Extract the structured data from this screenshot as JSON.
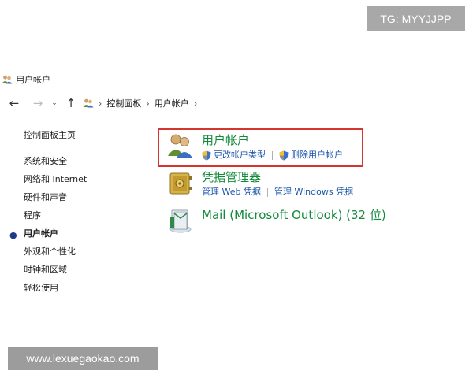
{
  "badge": {
    "text": "TG: MYYJJPP"
  },
  "window": {
    "title": "用户帐户"
  },
  "address": {
    "crumbs": [
      "控制面板",
      "用户帐户"
    ]
  },
  "sidebar": {
    "home": "控制面板主页",
    "items": [
      {
        "label": "系统和安全",
        "active": false
      },
      {
        "label": "网络和 Internet",
        "active": false
      },
      {
        "label": "硬件和声音",
        "active": false
      },
      {
        "label": "程序",
        "active": false
      },
      {
        "label": "用户帐户",
        "active": true
      },
      {
        "label": "外观和个性化",
        "active": false
      },
      {
        "label": "时钟和区域",
        "active": false
      },
      {
        "label": "轻松使用",
        "active": false
      }
    ]
  },
  "categories": [
    {
      "title": "用户帐户",
      "links": [
        "更改帐户类型",
        "删除用户帐户"
      ],
      "icon": "users-icon"
    },
    {
      "title": "凭据管理器",
      "links": [
        "管理 Web 凭据",
        "管理 Windows 凭据"
      ],
      "icon": "vault-icon"
    },
    {
      "title": "Mail (Microsoft Outlook) (32 位)",
      "links": [],
      "icon": "mail-icon"
    }
  ],
  "colors": {
    "category_title": "#128a3a",
    "link": "#1a55a8",
    "highlight": "#d4352c"
  },
  "watermark": {
    "text": "www.lexuegaokao.com"
  }
}
